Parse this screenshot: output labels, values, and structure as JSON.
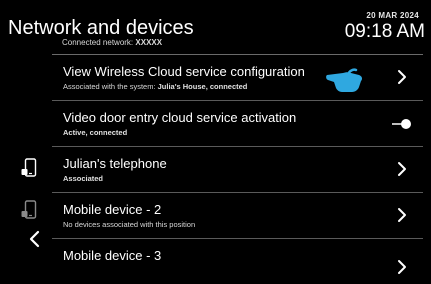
{
  "header": {
    "title": "Network and devices",
    "connected_label": "Connected network:",
    "connected_value": "XXXXX",
    "date": "20 MAR 2024",
    "time": "09:18 AM"
  },
  "rows": [
    {
      "title": "View Wireless Cloud service configuration",
      "sub_label": "Associated with the system:",
      "sub_value": "Julia's House, connected",
      "control": "chevron"
    },
    {
      "title": "Video door entry cloud service activation",
      "sub_value": "Active, connected",
      "control": "toggle"
    },
    {
      "title": "Julian's telephone",
      "sub_value": "Associated",
      "control": "chevron"
    },
    {
      "title": "Mobile device - 2",
      "sub_label": "No devices associated with this position",
      "control": "chevron"
    },
    {
      "title": "Mobile device - 3",
      "control": "chevron"
    }
  ],
  "icons": {
    "phone": "phone-icon",
    "back": "back-arrow-icon",
    "hand": "pointing-hand-icon"
  },
  "colors": {
    "background": "#000000",
    "accent": "#2fa8e0",
    "divider": "#5a5a5a"
  }
}
